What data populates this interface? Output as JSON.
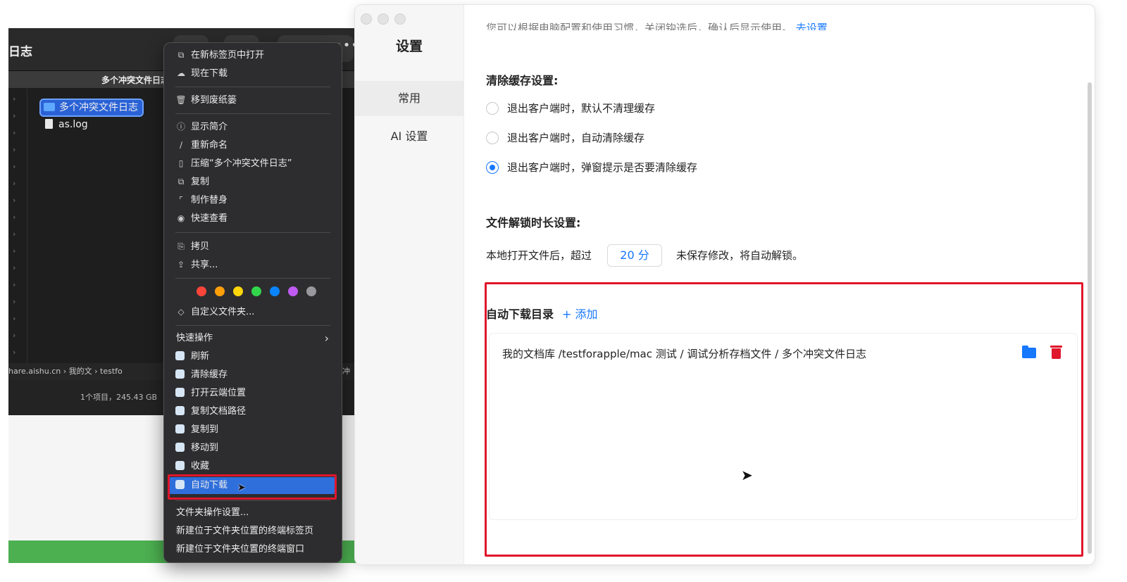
{
  "finder": {
    "window_title": "日志",
    "tab_label": "多个冲突文件日志",
    "files": [
      {
        "name": "多个冲突文件日志",
        "kind": "folder",
        "selected": true
      },
      {
        "name": "as.log",
        "kind": "file",
        "selected": false
      }
    ],
    "path_bar": "hare.aishu.cn › 我的文 › testfo",
    "path_tail": "冲",
    "status": "1个项目，245.43 GB"
  },
  "context_menu": {
    "open_new_tab": "在新标签页中打开",
    "download_now": "现在下载",
    "move_to_trash": "移到废纸篓",
    "get_info": "显示简介",
    "rename": "重新命名",
    "compress": "压缩“多个冲突文件日志”",
    "duplicate": "复制",
    "make_alias": "制作替身",
    "quick_look": "快速查看",
    "copy": "拷贝",
    "share": "共享...",
    "tag_colors": [
      "#ff453a",
      "#ff9f0a",
      "#ffd60a",
      "#32d74b",
      "#0a84ff",
      "#bf5af2",
      "#98989d"
    ],
    "custom_folder": "自定义文件夹...",
    "quick_actions": "快速操作",
    "app_actions": {
      "refresh": "刷新",
      "clear_cache": "清除缓存",
      "open_cloud": "打开云端位置",
      "copy_doc_path": "复制文档路径",
      "copy_to": "复制到",
      "move_to": "移动到",
      "favorite": "收藏",
      "auto_download": "自动下载"
    },
    "folder_action_settings": "文件夹操作设置...",
    "new_terminal_tab": "新建位于文件夹位置的终端标签页",
    "new_terminal_window": "新建位于文件夹位置的终端窗口"
  },
  "settings": {
    "title": "设置",
    "nav": {
      "general": "常用",
      "ai": "AI 设置"
    },
    "cut_text": "您可以根据电脑配置和使用习惯，关闭钩选后，确认后显示使用。",
    "cut_link": "去设置",
    "cache": {
      "title": "清除缓存设置:",
      "opt1": "退出客户端时，默认不清理缓存",
      "opt2": "退出客户端时，自动清除缓存",
      "opt3": "退出客户端时，弹窗提示是否要清除缓存",
      "selected_index": 2
    },
    "unlock": {
      "title": "文件解锁时长设置:",
      "before": "本地打开文件后，超过",
      "value": "20 分",
      "after": "未保存修改，将自动解锁。"
    },
    "auto_download": {
      "title": "自动下载目录",
      "add": "+ 添加",
      "path": "我的文档库 /testforapple/mac 测试 / 调试分析存档文件 / 多个冲突文件日志"
    }
  },
  "colors": {
    "accent": "#1677ff",
    "highlight": "#e0162b",
    "menu_highlight": "#2f6fdc"
  }
}
